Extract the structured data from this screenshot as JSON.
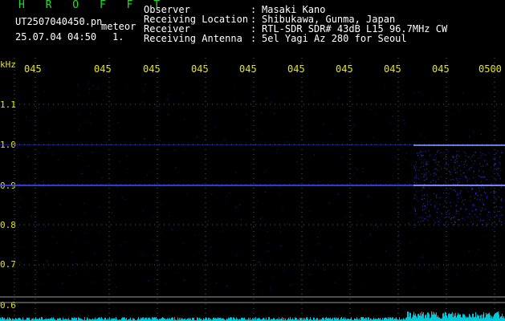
{
  "header": {
    "title": "H R O F F T",
    "filename": "UT2507040450.pn",
    "mode": "meteor",
    "timestamp": "25.07.04 04:50",
    "counter": "1.",
    "metadata": [
      {
        "label": "Observer",
        "value": "Masaki Kano"
      },
      {
        "label": "Receiving Location",
        "value": "Shibukawa, Gunma, Japan"
      },
      {
        "label": "Receiver",
        "value": "RTL-SDR SDR# 43dB L15 96.7MHz CW"
      },
      {
        "label": "Receiving Antenna",
        "value": "5el Yagi Az 280 for Seoul"
      }
    ]
  },
  "spectrogram": {
    "unit_label": "kHz",
    "y_ticks": [
      "1.1",
      "1.0",
      "0.9",
      "0.8",
      "0.7",
      "0.6"
    ],
    "x_ticks": [
      "045",
      "045",
      "045",
      "045",
      "045",
      "045",
      "045",
      "045",
      "045",
      "0500"
    ],
    "colors": {
      "background": "#000000",
      "grid": "#5a5a5a",
      "signal": "#3344ff",
      "signal_bright": "#7a8cff",
      "noise_floor": "#00c8d8",
      "axis_text": "#e8e800"
    }
  }
}
